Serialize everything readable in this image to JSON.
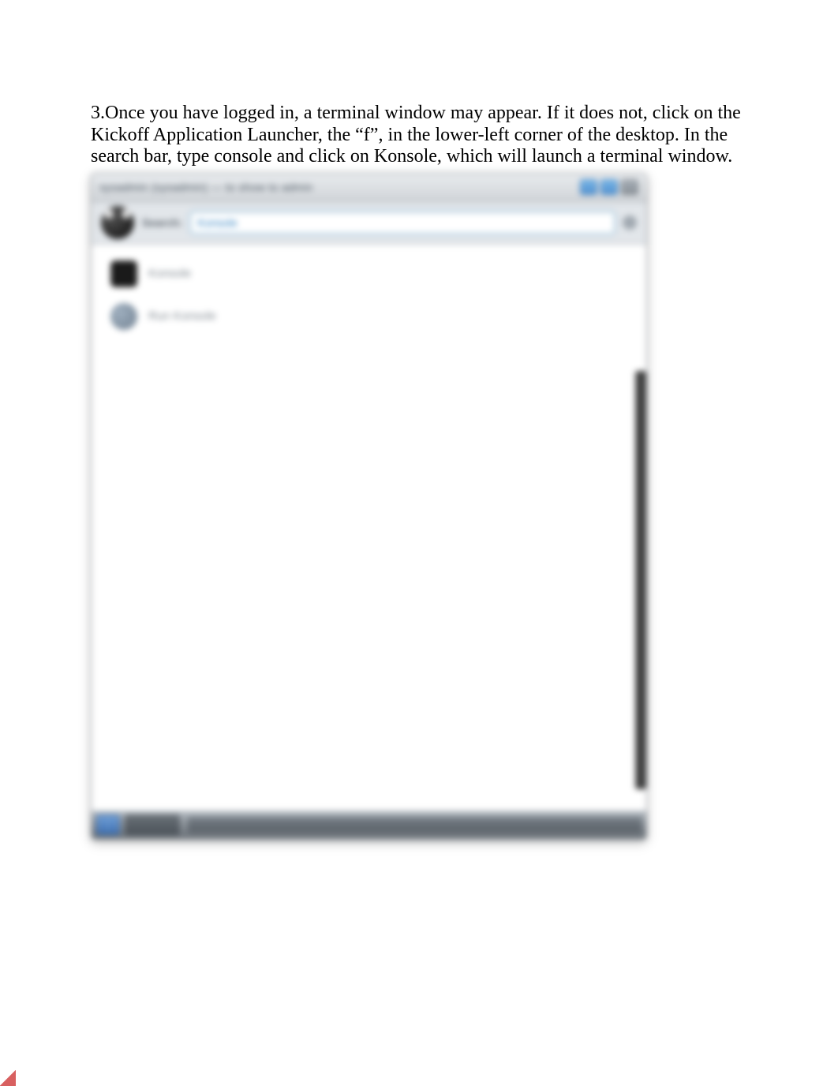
{
  "instruction": {
    "number": "3.",
    "text": "Once you have logged in, a terminal window may appear. If it does not, click on the Kickoff Application Launcher, the “f”, in the lower-left corner of the desktop. In the search bar, type console and click on Konsole, which will launch a terminal window."
  },
  "launcher": {
    "title_bar_text": "sysadmin (sysadmin) — to show to admin",
    "search_label": "Search:",
    "search_value": "Konsole",
    "results": [
      {
        "label": "Konsole",
        "icon": "konsole"
      },
      {
        "label": "Run Konsole",
        "icon": "run"
      }
    ]
  }
}
